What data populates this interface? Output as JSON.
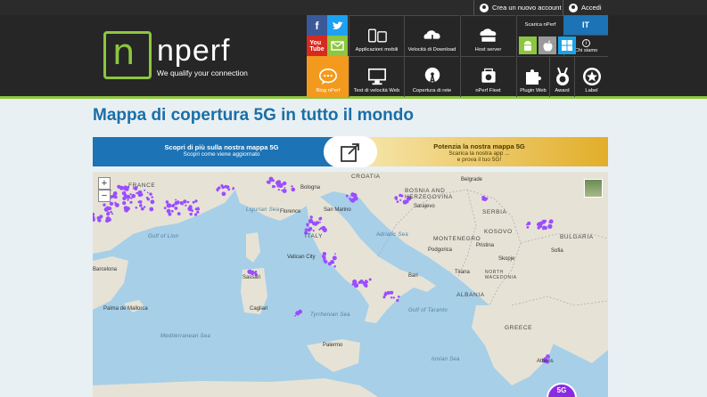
{
  "topbar": {
    "create_account": "Crea un nuovo account",
    "login": "Accedi"
  },
  "header": {
    "logo_word": "nperf",
    "logo_letter": "n",
    "tagline": "We qualify your connection",
    "tiles": [
      {
        "label": "Applicazioni mobili",
        "icon": "mobile-apps-icon"
      },
      {
        "label": "Velocità di Download",
        "icon": "download-speed-icon"
      },
      {
        "label": "Host server",
        "icon": "server-icon"
      },
      {
        "label": "Blog nPerf",
        "icon": "chat-bubble-icon"
      },
      {
        "label": "Test di velocità Web",
        "icon": "monitor-icon"
      },
      {
        "label": "Copertura di rete",
        "icon": "antenna-icon"
      },
      {
        "label": "nPerf Fleet",
        "icon": "fleet-icon"
      },
      {
        "label": "Plugin Web",
        "icon": "puzzle-icon"
      },
      {
        "label": "Award",
        "icon": "award-icon"
      },
      {
        "label": "Label",
        "icon": "star-badge-icon"
      }
    ],
    "download_label": "Scarica nPerf",
    "language": "IT",
    "about": "Chi siamo",
    "colors": {
      "accent_green": "#8dc63f",
      "blog_orange": "#f39a1e",
      "lang_blue": "#1c73b5"
    }
  },
  "page": {
    "title": "Mappa di copertura 5G in tutto il mondo",
    "banner_left_main": "Scopri di più sulla nostra mappa 5G",
    "banner_left_sub": "Scopri come viene aggiornato",
    "banner_right_main": "Potenzia la nostra mappa 5G",
    "banner_right_sub1": "Scarica la nostra app ...",
    "banner_right_sub2": "e prova il tuo 5G!"
  },
  "map": {
    "zoom_in": "+",
    "zoom_out": "−",
    "badge": "5G",
    "countries": [
      "CROATIA",
      "BOSNIA AND HERZEGOVINA",
      "SERBIA",
      "ITALY",
      "MONTENEGRO",
      "KOSOVO",
      "ALBANIA",
      "NORTH MACEDONIA",
      "BULGARIA",
      "GREECE",
      "FRANCE"
    ],
    "seas": [
      "Ligurian Sea",
      "Tyrrhenian Sea",
      "Adriatic Sea",
      "Ionian Sea",
      "Mediterranean Sea",
      "Gulf of Taranto",
      "Gulf of Lion"
    ],
    "cities": [
      "Bologna",
      "Florence",
      "San Marino",
      "Rome",
      "Vatican City",
      "Naples",
      "Barcelona",
      "Palma de Mallorca",
      "Sarajevo",
      "Belgrade",
      "Sofia",
      "Skopje",
      "Tirana",
      "Podgorica",
      "Pristina",
      "Bari",
      "Palermo",
      "Sassari",
      "Cagliari",
      "Athens"
    ],
    "coverage_color": "#9b4dff"
  }
}
